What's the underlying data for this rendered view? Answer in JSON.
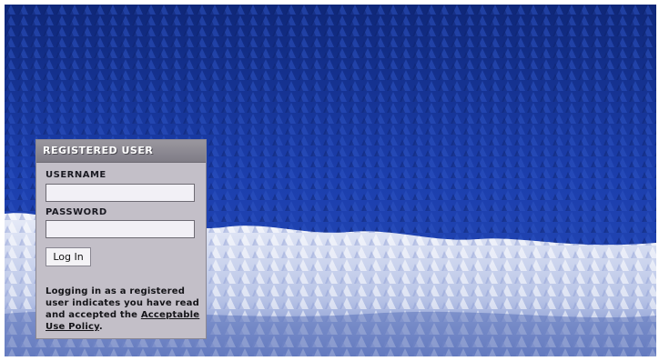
{
  "login_panel": {
    "header": "REGISTERED USER",
    "username_label": "USERNAME",
    "username_value": "",
    "password_label": "PASSWORD",
    "password_value": "",
    "login_button": "Log In",
    "notice_text": "Logging in as a registered user indicates you have read and accepted the",
    "policy_link": "Acceptable Use Policy",
    "notice_end": "."
  },
  "colors": {
    "panel_bg": "#c3bfc8",
    "header_bg": "#8a878f",
    "forest_blue": "#1a3ca8",
    "snow": "#dfe4f4"
  }
}
